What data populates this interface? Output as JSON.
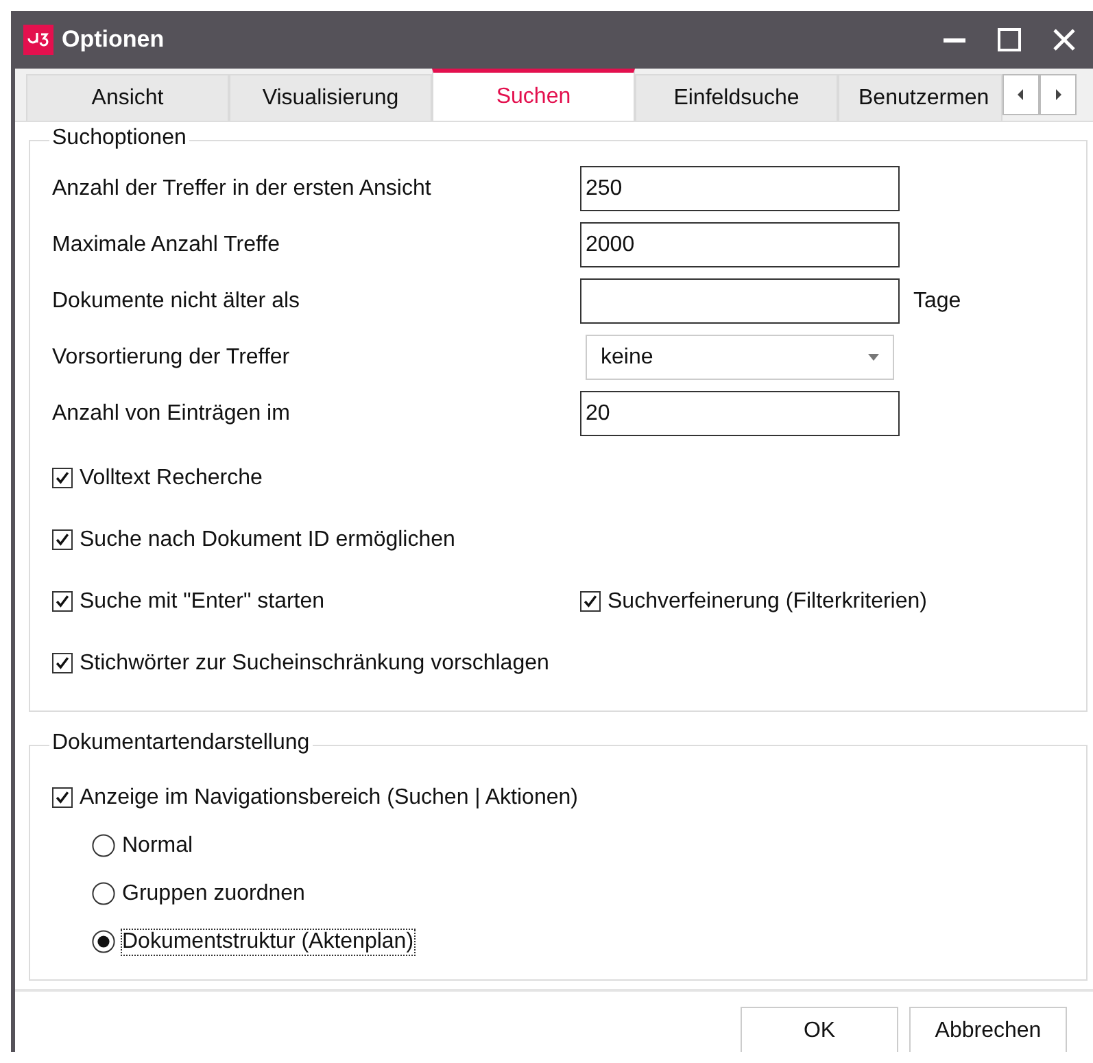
{
  "window": {
    "title": "Optionen"
  },
  "tabs": [
    {
      "label": "Ansicht",
      "selected": false
    },
    {
      "label": "Visualisierung",
      "selected": false
    },
    {
      "label": "Suchen",
      "selected": true
    },
    {
      "label": "Einfeldsuche",
      "selected": false
    },
    {
      "label": "Benutzermen",
      "selected": false
    }
  ],
  "search_options": {
    "title": "Suchoptionen",
    "fields": [
      {
        "kind": "text",
        "label": "Anzahl der Treffer in der ersten Ansicht",
        "value": "250"
      },
      {
        "kind": "text",
        "label": "Maximale Anzahl Treffe",
        "value": "2000"
      },
      {
        "kind": "text",
        "label": "Dokumente nicht älter als",
        "unit": "Tage"
      },
      {
        "kind": "select",
        "label": "Vorsortierung der Treffer",
        "value": "keine"
      },
      {
        "kind": "text",
        "label": "Anzahl von Einträgen im",
        "value": "20"
      }
    ],
    "checkbox_rows": [
      [
        {
          "label": "Volltext Recherche",
          "checked": true
        }
      ],
      [
        {
          "label": "Suche nach Dokument ID ermöglichen",
          "checked": true
        }
      ],
      [
        {
          "label": "Suche mit \"Enter\" starten",
          "checked": true
        },
        {
          "label": "Suchverfeinerung (Filterkriterien)",
          "checked": true
        }
      ],
      [
        {
          "label": "Stichwörter zur Sucheinschränkung vorschlagen",
          "checked": true
        }
      ]
    ]
  },
  "document_types": {
    "title": "Dokumentartendarstellung",
    "checkbox": {
      "label": "Anzeige im Navigationsbereich (Suchen | Aktionen)",
      "checked": true
    },
    "options": [
      {
        "label": "Normal",
        "selected": false,
        "focused": false
      },
      {
        "label": "Gruppen zuordnen",
        "selected": false,
        "focused": false
      },
      {
        "label": "Dokumentstruktur (Aktenplan)",
        "selected": true,
        "focused": true
      }
    ]
  },
  "buttons": [
    "OK",
    "Abbrechen"
  ]
}
